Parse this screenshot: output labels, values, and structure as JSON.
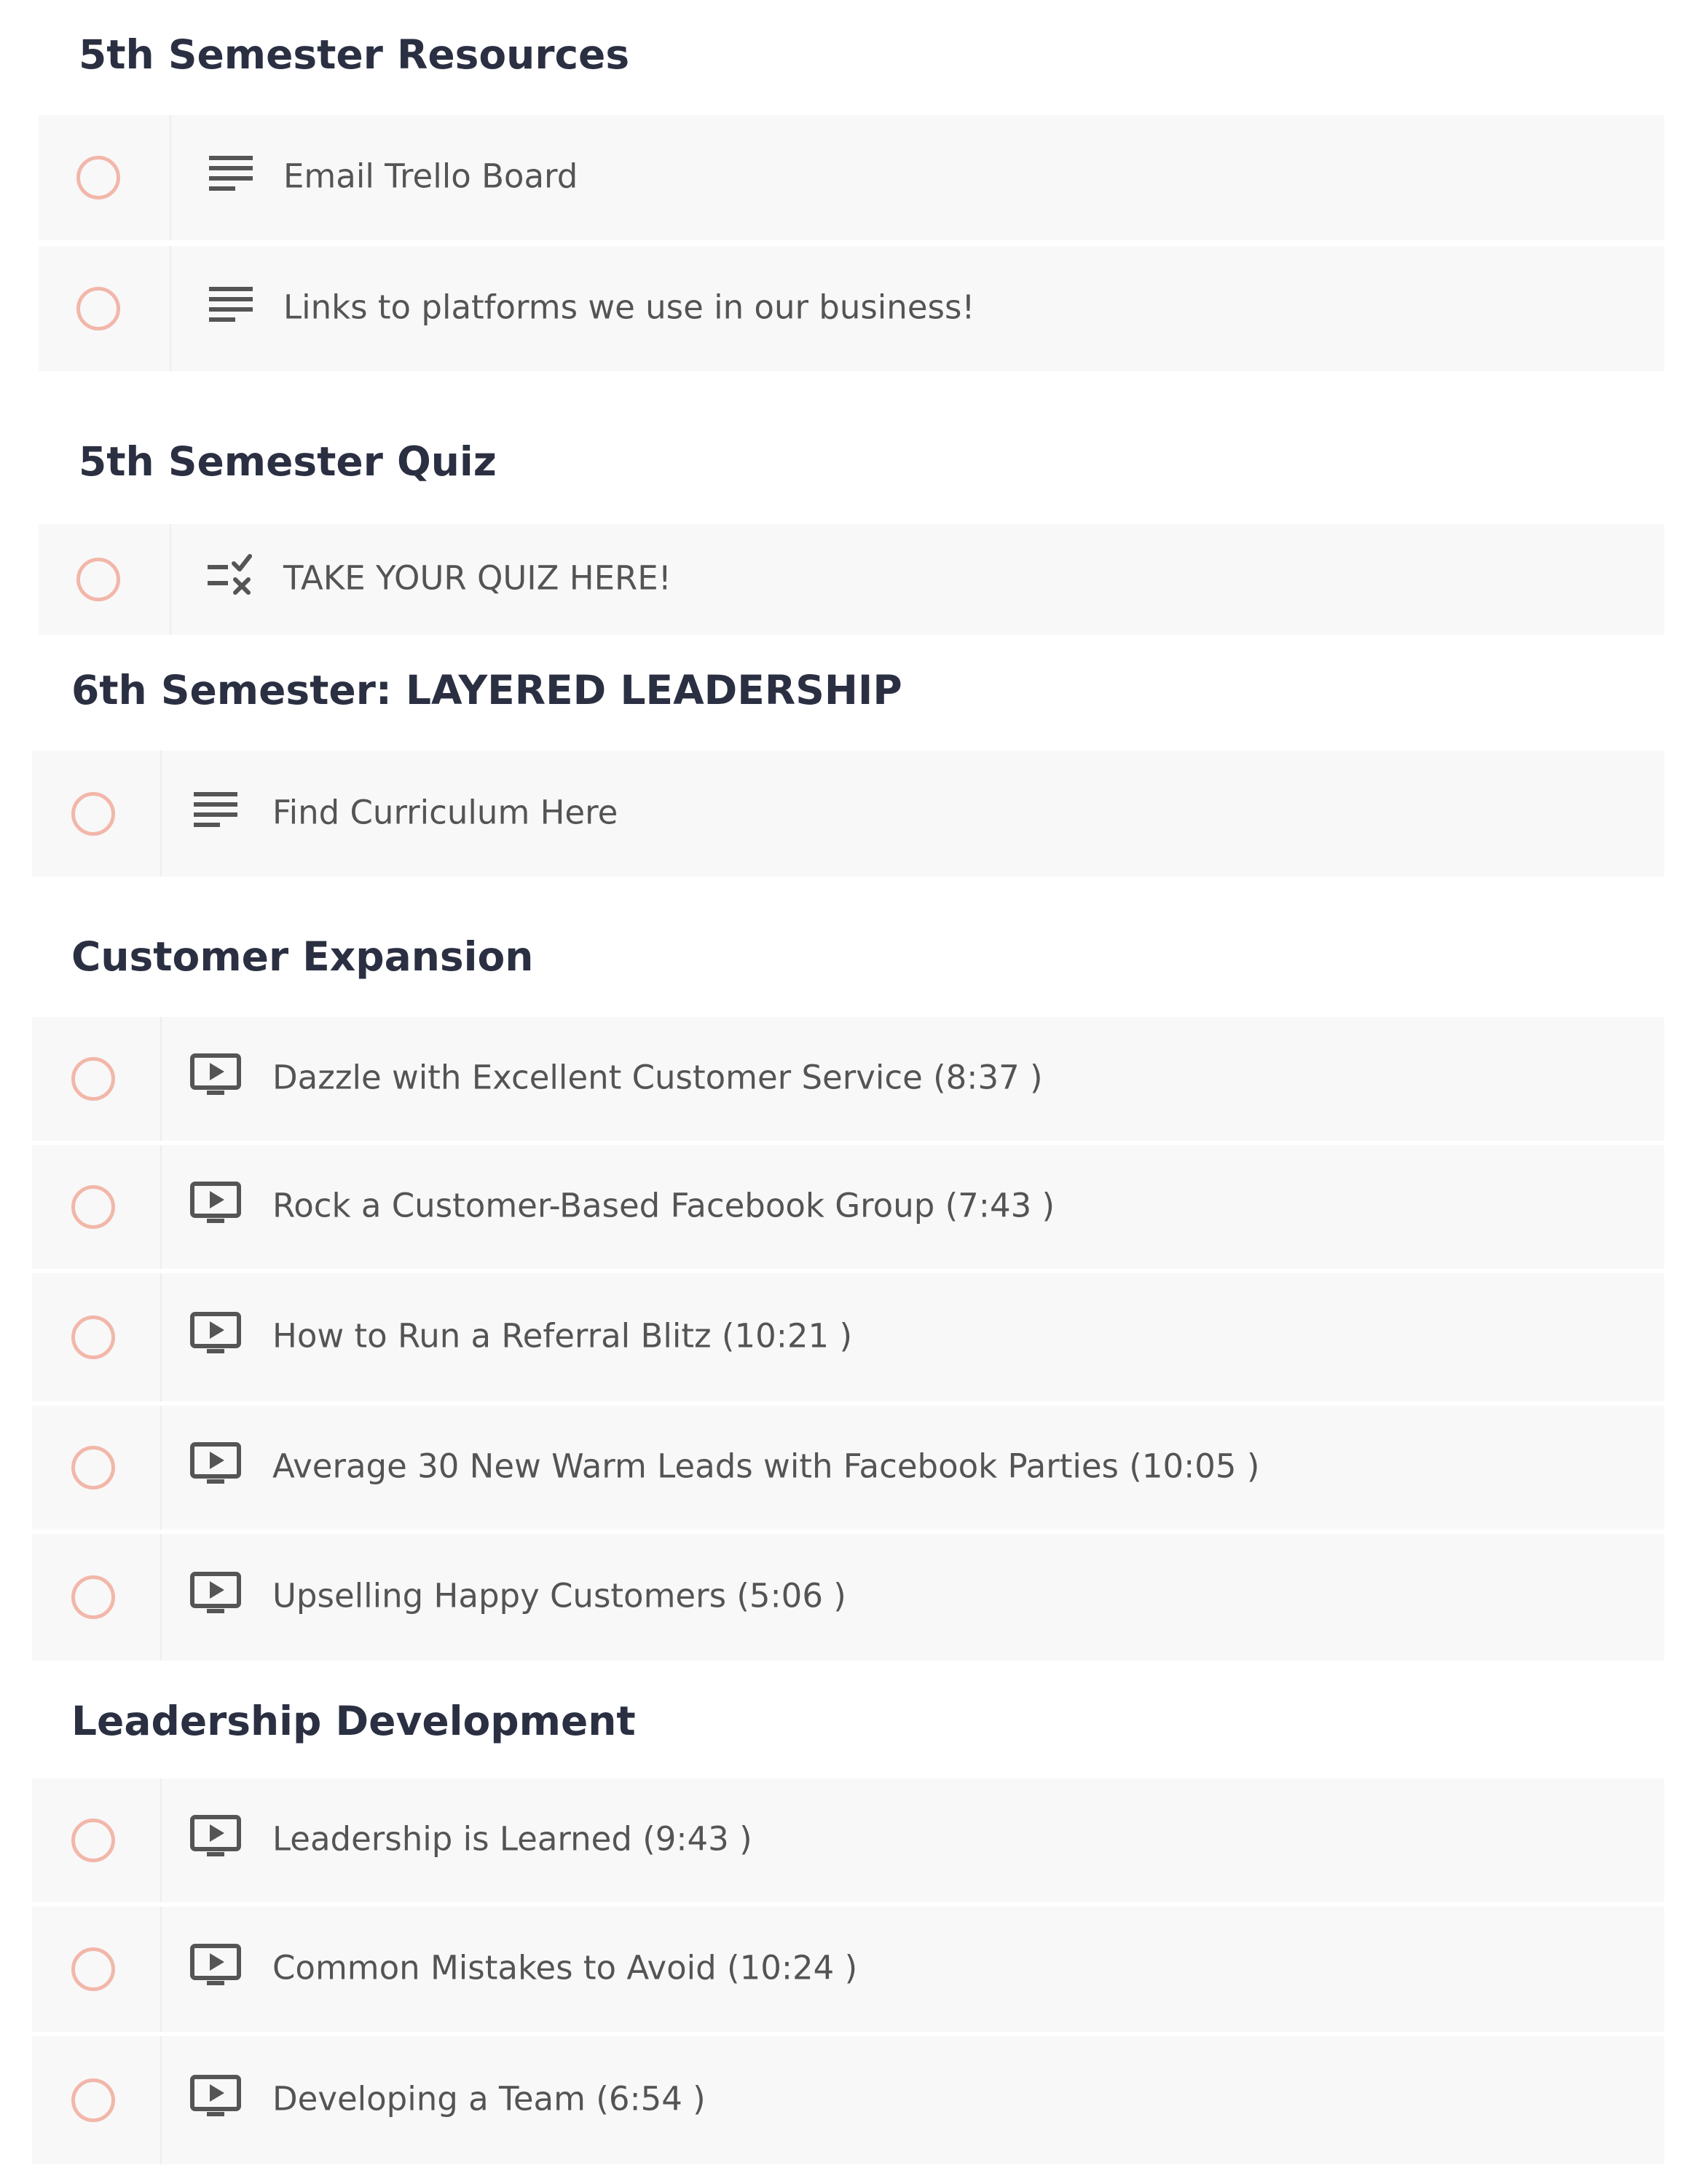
{
  "sections": [
    {
      "title": "5th Semester Resources",
      "lessons": [
        {
          "icon": "text-lines-icon",
          "label": "Email Trello Board"
        },
        {
          "icon": "text-lines-icon",
          "label": "Links to platforms we use in our business!"
        }
      ]
    },
    {
      "title": "5th Semester Quiz",
      "lessons": [
        {
          "icon": "quiz-checklist-icon",
          "label": "TAKE YOUR QUIZ HERE!"
        }
      ]
    },
    {
      "title": "6th Semester: LAYERED LEADERSHIP",
      "lessons": [
        {
          "icon": "text-lines-icon",
          "label": "Find Curriculum Here"
        }
      ]
    },
    {
      "title": "Customer Expansion",
      "lessons": [
        {
          "icon": "video-play-icon",
          "label": "Dazzle with Excellent Customer Service (8:37 )"
        },
        {
          "icon": "video-play-icon",
          "label": "Rock a Customer-Based Facebook Group (7:43 )"
        },
        {
          "icon": "video-play-icon",
          "label": "How to Run a Referral Blitz (10:21 )"
        },
        {
          "icon": "video-play-icon",
          "label": "Average 30 New Warm Leads with Facebook Parties (10:05 )"
        },
        {
          "icon": "video-play-icon",
          "label": "Upselling Happy Customers (5:06 )"
        }
      ]
    },
    {
      "title": "Leadership Development",
      "lessons": [
        {
          "icon": "video-play-icon",
          "label": "Leadership is Learned (9:43 )"
        },
        {
          "icon": "video-play-icon",
          "label": "Common Mistakes to Avoid (10:24 )"
        },
        {
          "icon": "video-play-icon",
          "label": "Developing a Team (6:54 )"
        }
      ]
    }
  ],
  "colors": {
    "heading": "#2b2f42",
    "row_background": "#f8f8f8",
    "status_circle": "#f2b7aa",
    "label_text": "#545454",
    "icon": "#555555"
  }
}
